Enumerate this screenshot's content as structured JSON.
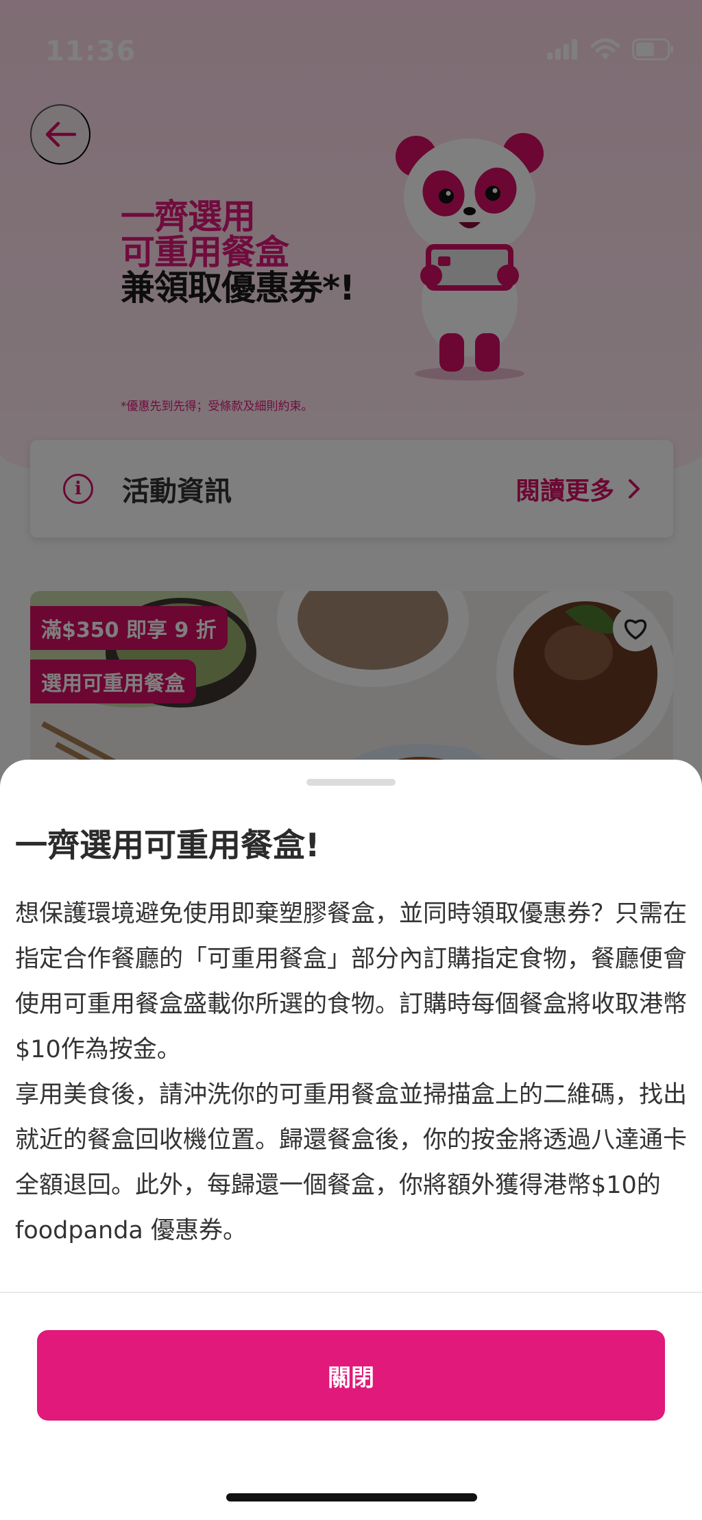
{
  "status_bar": {
    "time": "11:36"
  },
  "hero": {
    "title_line1": "一齊選用",
    "title_line2": "可重用餐盒",
    "title_line3": "兼領取優惠券",
    "title_suffix": "*!",
    "note": "*優惠先到先得；受條款及細則約束。"
  },
  "info_card": {
    "label": "活動資訊",
    "read_more": "閱讀更多"
  },
  "food_card": {
    "tags": [
      "滿$350 即享 9 折",
      "選用可重用餐盒"
    ]
  },
  "sheet": {
    "title": "一齊選用可重用餐盒!",
    "paragraphs": [
      "想保護環境避免使用即棄塑膠餐盒，並同時領取優惠券？只需在指定合作餐廳的「可重用餐盒」部分內訂購指定食物，餐廳便會使用可重用餐盒盛載你所選的食物。訂購時每個餐盒將收取港幣$10作為按金。",
      "享用美食後，請沖洗你的可重用餐盒並掃描盒上的二維碼，找出就近的餐盒回收機位置。歸還餐盒後，你的按金將透過八達通卡全額退回。此外，每歸還一個餐盒，你將額外獲得港幣$10的foodpanda 優惠券。"
    ],
    "close_label": "關閉"
  },
  "colors": {
    "brand": "#d70f64",
    "button": "#e0197a"
  },
  "icons": [
    "back-arrow-icon",
    "signal-icon",
    "wifi-icon",
    "battery-icon",
    "info-icon",
    "chevron-right-icon",
    "heart-icon",
    "panda-mascot"
  ]
}
